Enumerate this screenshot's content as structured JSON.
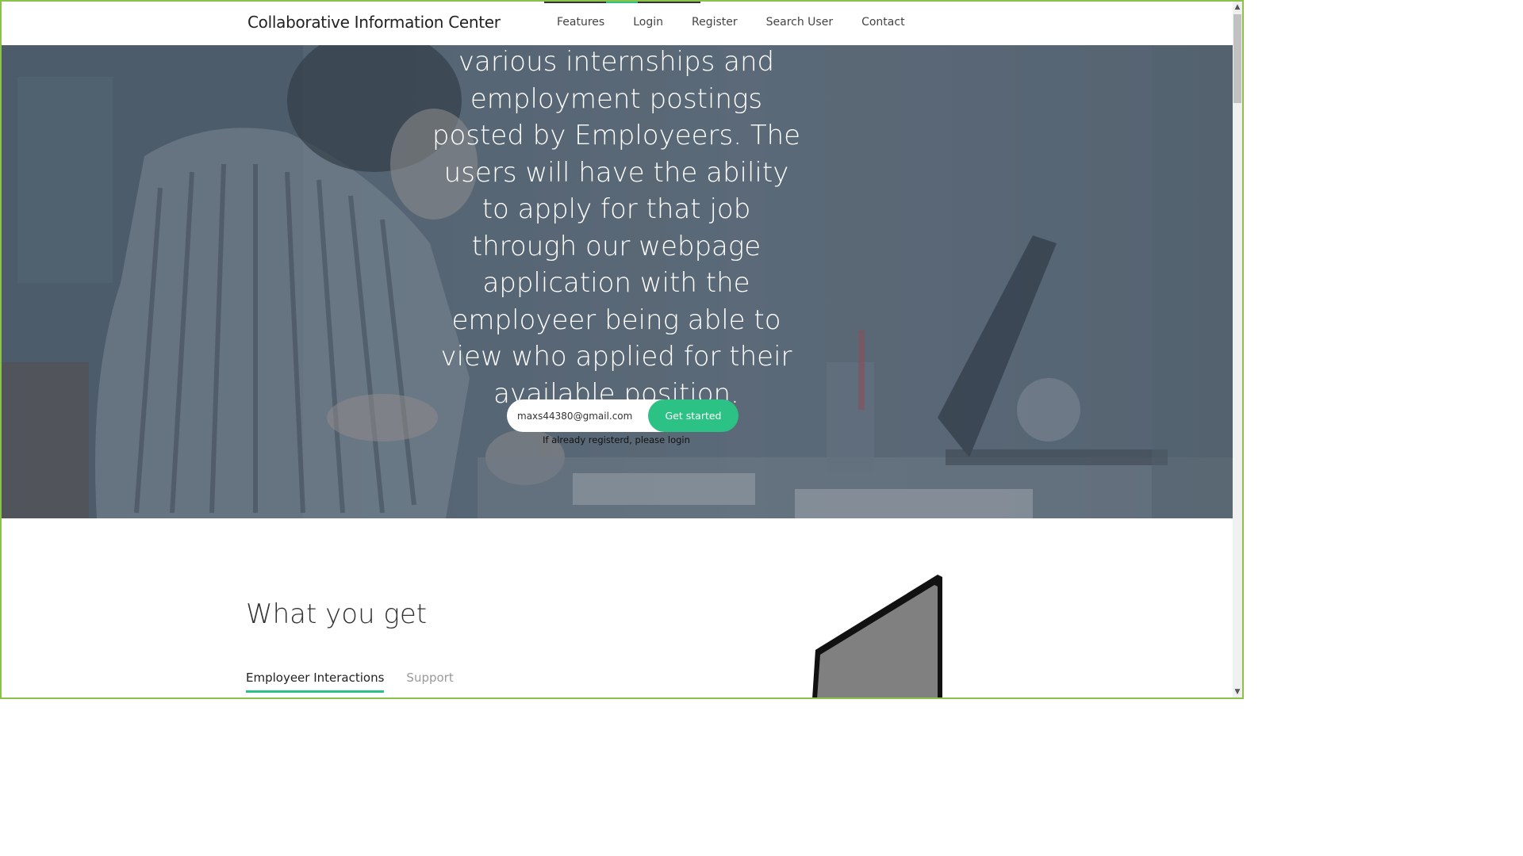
{
  "navbar": {
    "brand": "Collaborative Information Center",
    "links": [
      "Features",
      "Login",
      "Register",
      "Search User",
      "Contact"
    ]
  },
  "hero": {
    "text": "various internships and employment postings posted by Employeers. The users will have the ability to apply for that job through our webpage application with the employeer being able to view who applied for their available position.",
    "email_value": "maxs44380@gmail.com",
    "button_label": "Get started",
    "login_hint": "If already registerd, please login"
  },
  "features": {
    "title": "What you get",
    "tabs": [
      "Employeer Interactions",
      "Support"
    ],
    "active_tab": "Employeer Interactions"
  },
  "colors": {
    "accent": "#2cc185",
    "frame": "#8bc34a"
  }
}
